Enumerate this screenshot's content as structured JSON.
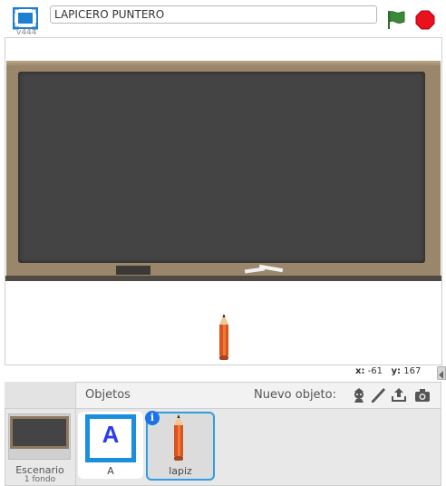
{
  "header": {
    "version": "v444",
    "project_title": "LAPICERO PUNTERO",
    "icons": {
      "fullscreen": "fullscreen-icon",
      "go": "green-flag-icon",
      "stop": "stop-icon"
    }
  },
  "stage": {
    "backdrop": "chalkboard",
    "sprite": "pencil",
    "coords": {
      "x_label": "x:",
      "x_value": "-61",
      "y_label": "y:",
      "y_value": "167"
    }
  },
  "stage_panel": {
    "name": "Escenario",
    "count": "1 fondo"
  },
  "sprites_panel": {
    "title": "Objetos",
    "new_object_label": "Nuevo objeto:",
    "new_object_icons": [
      "library-sprite-icon",
      "paint-brush-icon",
      "upload-icon",
      "camera-icon"
    ],
    "sprites": [
      {
        "name": "A",
        "thumbnail": "letter-a",
        "letter": "A",
        "selected": false
      },
      {
        "name": "lapiz",
        "thumbnail": "pencil",
        "selected": true
      }
    ]
  },
  "colors": {
    "accent": "#2f9ee0",
    "stop": "#e8111c",
    "flag": "#3a8a3a",
    "board": "#444444",
    "frame": "#9a876b"
  }
}
